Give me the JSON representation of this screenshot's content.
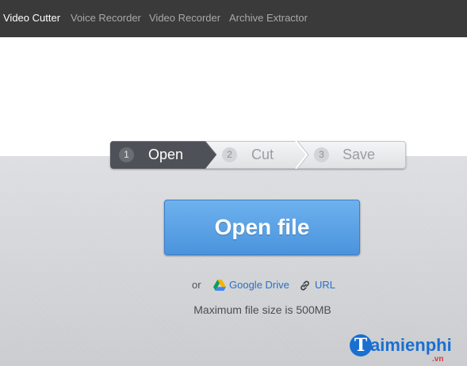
{
  "nav": {
    "items": [
      {
        "label": "Video Cutter",
        "active": true
      },
      {
        "label": "Voice Recorder",
        "active": false
      },
      {
        "label": "Video Recorder",
        "active": false
      },
      {
        "label": "Archive Extractor",
        "active": false
      }
    ]
  },
  "steps": [
    {
      "number": "1",
      "label": "Open",
      "active": true
    },
    {
      "number": "2",
      "label": "Cut",
      "active": false
    },
    {
      "number": "3",
      "label": "Save",
      "active": false
    }
  ],
  "main": {
    "open_button_label": "Open file",
    "or_text": "or",
    "google_drive_label": "Google Drive",
    "url_label": "URL",
    "max_size_text": "Maximum file size is 500MB"
  },
  "watermark": {
    "letter": "T",
    "text": "aimienphi",
    "domain": ".vn"
  },
  "colors": {
    "topbar": "#3a3a3a",
    "accent_blue": "#4a93dd",
    "link_blue": "#2b6fc6",
    "active_step": "#4e5157"
  },
  "icons": [
    "google-drive-icon",
    "link-icon"
  ]
}
